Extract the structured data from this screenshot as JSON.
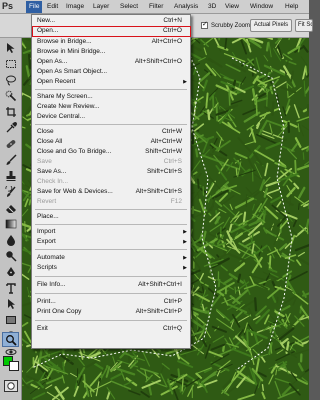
{
  "app": {
    "logo": "Ps"
  },
  "menubar": {
    "items": [
      "File",
      "Edit",
      "Image",
      "Layer",
      "Select",
      "Filter",
      "Analysis",
      "3D",
      "View",
      "Window",
      "Help"
    ]
  },
  "options_bar": {
    "scrubby_zoom_checked": true,
    "scrubby_zoom_label": "Scrubby Zoom",
    "actual_pixels_label": "Actual Pixels",
    "fit_screen_label": "Fit Screen"
  },
  "toolbox": {
    "tools": [
      "move-icon",
      "marquee-icon",
      "lasso-icon",
      "quick-select-icon",
      "crop-icon",
      "eyedropper-icon",
      "spot-healing-icon",
      "brush-icon",
      "clone-stamp-icon",
      "history-brush-icon",
      "eraser-icon",
      "gradient-icon",
      "blur-icon",
      "dodge-icon",
      "pen-icon",
      "type-icon",
      "path-select-icon",
      "shape-icon",
      "3d-rotate-icon",
      "3d-orbit-icon",
      "hand-icon",
      "zoom-icon"
    ],
    "foreground_color": "#00c800",
    "background_color": "#ffffff"
  },
  "file_menu": {
    "items": [
      {
        "label": "New...",
        "shortcut": "Ctrl+N"
      },
      {
        "label": "Open...",
        "shortcut": "Ctrl+O",
        "highlighted": true
      },
      {
        "label": "Browse in Bridge...",
        "shortcut": "Alt+Ctrl+O"
      },
      {
        "label": "Browse in Mini Bridge...",
        "shortcut": ""
      },
      {
        "label": "Open As...",
        "shortcut": "Alt+Shift+Ctrl+O"
      },
      {
        "label": "Open As Smart Object...",
        "shortcut": ""
      },
      {
        "label": "Open Recent",
        "shortcut": "",
        "submenu": true
      },
      {
        "label": "Share My Screen...",
        "shortcut": ""
      },
      {
        "label": "Create New Review...",
        "shortcut": ""
      },
      {
        "label": "Device Central...",
        "shortcut": ""
      },
      {
        "label": "Close",
        "shortcut": "Ctrl+W"
      },
      {
        "label": "Close All",
        "shortcut": "Alt+Ctrl+W"
      },
      {
        "label": "Close and Go To Bridge...",
        "shortcut": "Shift+Ctrl+W"
      },
      {
        "label": "Save",
        "shortcut": "Ctrl+S",
        "disabled": true
      },
      {
        "label": "Save As...",
        "shortcut": "Shift+Ctrl+S"
      },
      {
        "label": "Check In...",
        "shortcut": "",
        "disabled": true
      },
      {
        "label": "Save for Web & Devices...",
        "shortcut": "Alt+Shift+Ctrl+S"
      },
      {
        "label": "Revert",
        "shortcut": "F12",
        "disabled": true
      },
      {
        "label": "Place...",
        "shortcut": ""
      },
      {
        "label": "Import",
        "shortcut": "",
        "submenu": true
      },
      {
        "label": "Export",
        "shortcut": "",
        "submenu": true
      },
      {
        "label": "Automate",
        "shortcut": "",
        "submenu": true
      },
      {
        "label": "Scripts",
        "shortcut": "",
        "submenu": true
      },
      {
        "label": "File Info...",
        "shortcut": "Alt+Shift+Ctrl+I"
      },
      {
        "label": "Print...",
        "shortcut": "Ctrl+P"
      },
      {
        "label": "Print One Copy",
        "shortcut": "Alt+Shift+Ctrl+P"
      },
      {
        "label": "Exit",
        "shortcut": "Ctrl+Q"
      }
    ]
  },
  "colors": {
    "menu_highlight": "#2f5fa3",
    "open_highlight_border": "#d8121a",
    "grass_dark": "#2f5a14",
    "grass_light": "#7fb23a"
  }
}
